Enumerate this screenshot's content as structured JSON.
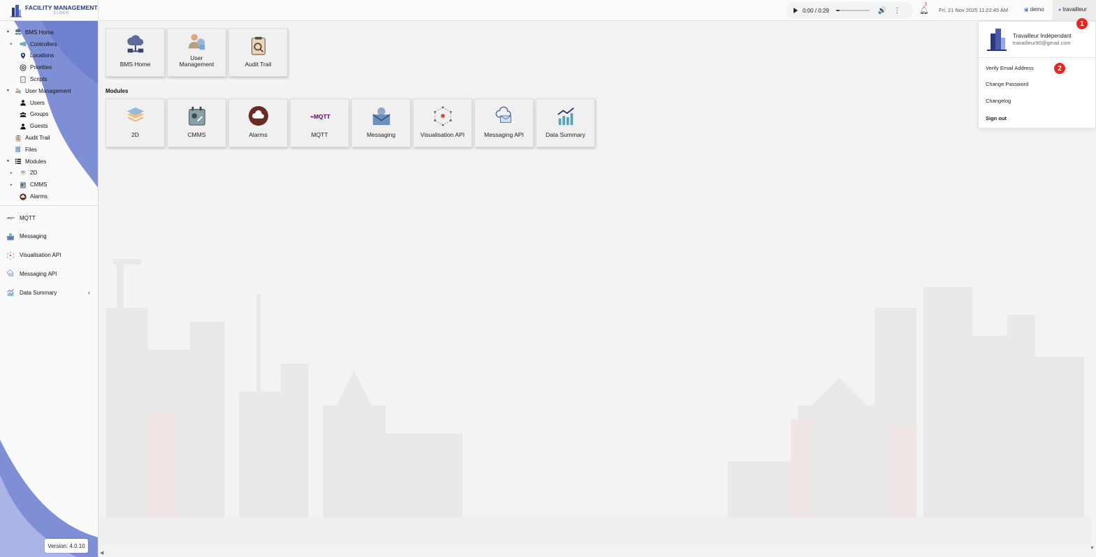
{
  "header": {
    "logo": {
      "line1": "FACILITY MANAGEMENT",
      "line2": "CLOUD"
    },
    "player": {
      "time": "0:00 / 0:29",
      "progress": 0.1
    },
    "notifications_count": "5",
    "datetime": "Fri, 21 Nov 2025 11:22:45 AM",
    "tenant": "demo",
    "user": "travailleur"
  },
  "sidebar": {
    "tree": [
      {
        "label": "BMS Home",
        "icon": "cloud-network-icon",
        "level": 0,
        "caret": true
      },
      {
        "label": "Controllers",
        "icon": "controllers-icon",
        "level": 1,
        "caret": true
      },
      {
        "label": "Locations",
        "icon": "map-pin-icon",
        "level": 1,
        "caret": false
      },
      {
        "label": "Priorities",
        "icon": "lifebuoy-icon",
        "level": 1,
        "caret": false
      },
      {
        "label": "Scripts",
        "icon": "script-icon",
        "level": 1,
        "caret": false
      },
      {
        "label": "User Management",
        "icon": "users-cloud-icon",
        "level": 0,
        "caret": true
      },
      {
        "label": "Users",
        "icon": "user-icon",
        "level": 1,
        "caret": false
      },
      {
        "label": "Groups",
        "icon": "group-icon",
        "level": 1,
        "caret": false
      },
      {
        "label": "Guests",
        "icon": "guest-icon",
        "level": 1,
        "caret": false
      },
      {
        "label": "Audit Trail",
        "icon": "clipboard-icon",
        "level": 0,
        "caret": false
      },
      {
        "label": "Files",
        "icon": "files-icon",
        "level": 0,
        "caret": false
      },
      {
        "label": "Modules",
        "icon": "list-icon",
        "level": 0,
        "caret": true
      },
      {
        "label": "2D",
        "icon": "layers-icon",
        "level": 1,
        "caret": true
      },
      {
        "label": "CMMS",
        "icon": "cmms-icon",
        "level": 1,
        "caret": true
      },
      {
        "label": "Alarms",
        "icon": "alarm-cloud-icon",
        "level": 1,
        "caret": false
      }
    ],
    "flat": [
      {
        "label": "MQTT",
        "icon": "mqtt-icon"
      },
      {
        "label": "Messaging",
        "icon": "envelope-icon"
      },
      {
        "label": "Visualisation API",
        "icon": "network-icon"
      },
      {
        "label": "Messaging API",
        "icon": "mail-cloud-icon"
      },
      {
        "label": "Data Summary",
        "icon": "chart-icon",
        "chevron": "‹"
      }
    ],
    "version": "Version: 4.0.10"
  },
  "main": {
    "top_tiles": [
      {
        "label": "BMS Home",
        "icon": "cloud-network-icon"
      },
      {
        "label": "User Management",
        "icon": "users-cloud-icon"
      },
      {
        "label": "Audit Trail",
        "icon": "clipboard-icon"
      }
    ],
    "modules_label": "Modules",
    "module_tiles": [
      {
        "label": "2D",
        "icon": "layers-icon"
      },
      {
        "label": "CMMS",
        "icon": "cmms-icon"
      },
      {
        "label": "Alarms",
        "icon": "alarm-cloud-icon"
      },
      {
        "label": "MQTT",
        "icon": "mqtt-icon"
      },
      {
        "label": "Messaging",
        "icon": "envelope-icon"
      },
      {
        "label": "Visualisation API",
        "icon": "network-icon"
      },
      {
        "label": "Messaging API",
        "icon": "mail-cloud-icon"
      },
      {
        "label": "Data Summary",
        "icon": "chart-icon"
      }
    ]
  },
  "dropdown": {
    "name": "Travailleur Indépendant",
    "email": "travailleur90@gmail.com",
    "items": [
      "Verify Email Address",
      "Change Password",
      "Changelog",
      "Sign out"
    ]
  },
  "badges": [
    "1",
    "2"
  ],
  "colors": {
    "sidebar_swoosh": "#7f8fd6",
    "accent": "#2c3a7a",
    "badge": "#e8281e",
    "alarm": "#6b2a22"
  }
}
